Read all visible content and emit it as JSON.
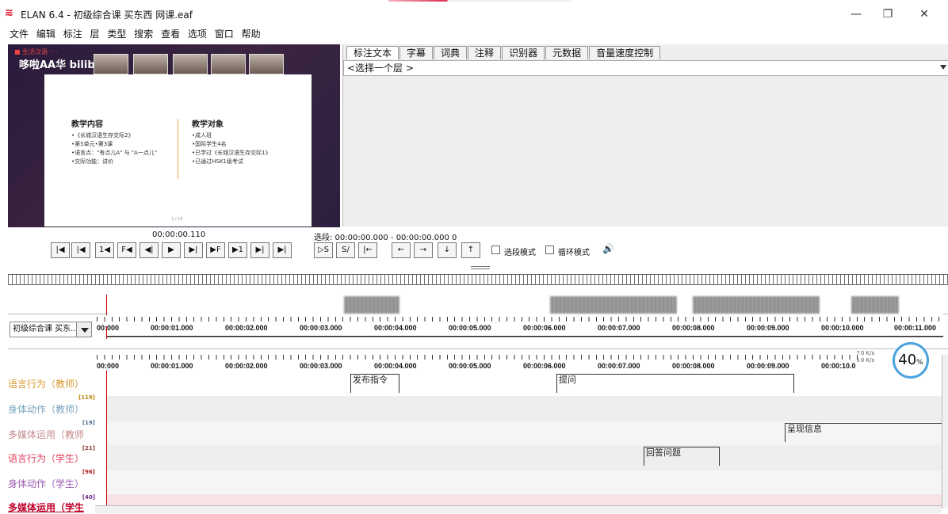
{
  "window": {
    "title": "ELAN 6.4 - 初级综合课 买东西 网课.eaf",
    "minimize": "—",
    "restore": "❐",
    "close": "✕"
  },
  "menu": [
    "文件",
    "编辑",
    "标注",
    "层",
    "类型",
    "搜索",
    "查看",
    "选项",
    "窗口",
    "帮助"
  ],
  "video": {
    "logo_small": "■ 生活汉语 ····",
    "logo_brand": "哆啦AA华 bilibili",
    "slide": {
      "left_title": "教学内容",
      "left_items": [
        "•《长城汉语生存交际2》",
        "•第5单元•第3课",
        "•语言点：\"有点儿A\" 与 \"A一点儿\"",
        "•交际功能：讲价"
      ],
      "right_title": "教学对象",
      "right_items": [
        "•成人班",
        "•国际学生4名",
        "•已学过《长城汉语生存交际1》",
        "•已通过HSK1级考试"
      ],
      "page_num": "3 / 18"
    }
  },
  "tabs": [
    "标注文本",
    "字幕",
    "词典",
    "注释",
    "识别器",
    "元数据",
    "音量速度控制"
  ],
  "tier_select_placeholder": "<选择一个层 >",
  "player": {
    "current_time": "00:00:00.110",
    "selection": "选段: 00:00:00.000 - 00:00:00.000 0",
    "buttons": [
      "|◀",
      "|◀",
      "1◀",
      "F◀",
      "◀|",
      "▶",
      "▶|",
      "▶F",
      "▶1",
      "▶|",
      "▶|"
    ],
    "sel_buttons": [
      "▷S",
      "S/",
      "|←",
      "←",
      "→",
      "↓",
      "↑"
    ],
    "selection_mode": "选段模式",
    "loop_mode": "循环模式",
    "volume_icon": "🔊"
  },
  "tier_dropdown": "初级综合课 买东...",
  "ruler_ticks": [
    "00:000",
    "00:00:01.000",
    "00:00:02.000",
    "00:00:03.000",
    "00:00:04.000",
    "00:00:05.000",
    "00:00:06.000",
    "00:00:07.000",
    "00:00:08.000",
    "00:00:09.000",
    "00:00:10.000",
    "00:00:11.000"
  ],
  "ruler2_ticks": [
    "00:000",
    "00:00:01.000",
    "00:00:02.000",
    "00:00:03.000",
    "00:00:04.000",
    "00:00:05.000",
    "00:00:06.000",
    "00:00:07.000",
    "00:00:08.000",
    "00:00:09.000",
    "00:00:10.0"
  ],
  "tiers": [
    {
      "name": "语言行为（教师）",
      "count": "[119]",
      "color": "#d99a2e",
      "count_color": "#b8860b"
    },
    {
      "name": "身体动作（教师）",
      "count": "[19]",
      "color": "#7aa3bf",
      "count_color": "#4a6f8c"
    },
    {
      "name": "多媒体运用（教师",
      "count": "[21]",
      "color": "#c58a8a",
      "count_color": "#8a3a3a"
    },
    {
      "name": "语言行为（学生）",
      "count": "[96]",
      "color": "#e0405c",
      "count_color": "#b22222"
    },
    {
      "name": "身体动作（学生）",
      "count": "[40]",
      "color": "#9b5bb3",
      "count_color": "#6a2c8a"
    },
    {
      "name": "多媒体运用（学生",
      "count": "",
      "color": "#c0002a",
      "count_color": "#c0002a"
    }
  ],
  "annotations": {
    "a1": "发布指令",
    "a2": "提问",
    "a3": "呈现信息",
    "a4": "回答问题"
  },
  "overlay": {
    "percent": "40",
    "unit": "%",
    "up": "↑0 K/s",
    "down": "↓0 K/s"
  }
}
